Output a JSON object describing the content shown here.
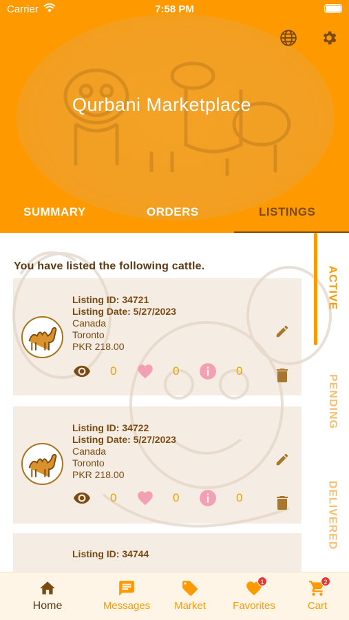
{
  "status_bar": {
    "carrier": "Carrier",
    "time": "7:58 PM"
  },
  "header": {
    "title": "Qurbani Marketplace",
    "icons": [
      "globe-icon",
      "gear-icon"
    ],
    "colors": {
      "brand": "#FF9900",
      "accent_dark": "#7a4a12"
    }
  },
  "tabs": [
    {
      "label": "SUMMARY",
      "selected": false
    },
    {
      "label": "ORDERS",
      "selected": false
    },
    {
      "label": "LISTINGS",
      "selected": true
    }
  ],
  "listings": {
    "intro": "You have listed the following cattle.",
    "cards": [
      {
        "id_line": "Listing ID: 34721",
        "date_line": "Listing Date: 5/27/2023",
        "country": "Canada",
        "city": "Toronto",
        "price": "PKR 218.00",
        "views": "0",
        "likes": "0",
        "info": "0"
      },
      {
        "id_line": "Listing ID: 34722",
        "date_line": "Listing Date: 5/27/2023",
        "country": "Canada",
        "city": "Toronto",
        "price": "PKR 218.00",
        "views": "0",
        "likes": "0",
        "info": "0"
      },
      {
        "id_line": "Listing ID: 34744"
      }
    ]
  },
  "side_tabs": [
    {
      "label": "ACTIVE",
      "selected": true
    },
    {
      "label": "PENDING",
      "selected": false
    },
    {
      "label": "DELIVERED",
      "selected": false
    }
  ],
  "bottom_nav": [
    {
      "label": "Home",
      "icon": "home-icon",
      "selected": true
    },
    {
      "label": "Messages",
      "icon": "message-icon"
    },
    {
      "label": "Market",
      "icon": "tag-icon"
    },
    {
      "label": "Favorites",
      "icon": "heart-icon",
      "badge": "1"
    },
    {
      "label": "Cart",
      "icon": "cart-icon",
      "badge": "2"
    }
  ]
}
